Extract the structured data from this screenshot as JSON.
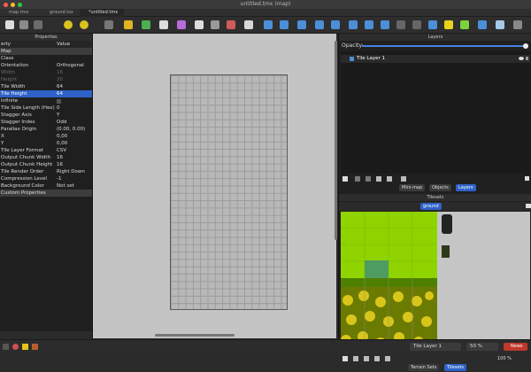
{
  "window": {
    "title": "untitled.tmx (map)"
  },
  "tabs": [
    {
      "label": "map.tmx"
    },
    {
      "label": "ground.tsx"
    },
    {
      "label": "*untitled.tmx"
    }
  ],
  "properties": {
    "title": "Properties",
    "header": {
      "key": "erty",
      "value": "Value"
    },
    "rows": [
      {
        "k": "Map",
        "v": "",
        "style": "sec"
      },
      {
        "k": "Class",
        "v": "",
        "style": ""
      },
      {
        "k": "Orientation",
        "v": "Orthogonal",
        "style": ""
      },
      {
        "k": "Width",
        "v": "16",
        "style": "dim"
      },
      {
        "k": "Height",
        "v": "20",
        "style": "dim"
      },
      {
        "k": "Tile Width",
        "v": "64",
        "style": ""
      },
      {
        "k": "Tile Height",
        "v": "64",
        "style": "sel"
      },
      {
        "k": "Infinite",
        "v": "",
        "style": ""
      },
      {
        "k": "Tile Side Length (Hex)",
        "v": "0",
        "style": ""
      },
      {
        "k": "Stagger Axis",
        "v": "Y",
        "style": ""
      },
      {
        "k": "Stagger Index",
        "v": "Odd",
        "style": ""
      },
      {
        "k": "Parallax Origin",
        "v": "(0.00, 0.00)",
        "style": ""
      },
      {
        "k": "   X",
        "v": "0,00",
        "style": ""
      },
      {
        "k": "   Y",
        "v": "0,00",
        "style": ""
      },
      {
        "k": "Tile Layer Format",
        "v": "CSV",
        "style": ""
      },
      {
        "k": "Output Chunk Width",
        "v": "16",
        "style": ""
      },
      {
        "k": "Output Chunk Height",
        "v": "16",
        "style": ""
      },
      {
        "k": "Tile Render Order",
        "v": "Right Down",
        "style": ""
      },
      {
        "k": "Compression Level",
        "v": "-1",
        "style": ""
      },
      {
        "k": "Background Color",
        "v": "Not set",
        "style": ""
      },
      {
        "k": "Custom Properties",
        "v": "",
        "style": "sec"
      }
    ]
  },
  "layers": {
    "title": "Layers",
    "opacity_label": "Opacity:",
    "layer_name": "Tile Layer 1",
    "opacity_value_pct": 100
  },
  "layer_tabs": [
    {
      "label": "Mini-map"
    },
    {
      "label": "Objects"
    },
    {
      "label": "Layers"
    }
  ],
  "tilesets": {
    "title": "Tilesets",
    "active_tab": "ground",
    "zoom": "100 %"
  },
  "tileset_tabs": [
    {
      "label": "Terrain Sets"
    },
    {
      "label": "Tilesets"
    }
  ],
  "status": {
    "layer": "Tile Layer 1",
    "zoom": "50 %",
    "news": "News"
  },
  "colors": {
    "accent": "#2e62c7",
    "grass": "#8fd400",
    "forest": "#6b7a00"
  }
}
